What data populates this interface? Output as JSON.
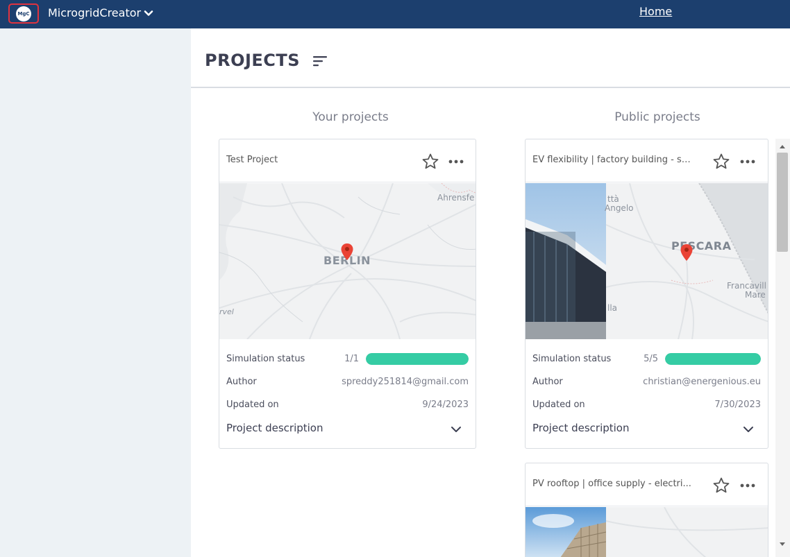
{
  "topbar": {
    "logo_text": "MgC",
    "app_name": "MicrogridCreator",
    "home_link": "Home"
  },
  "page": {
    "title": "PROJECTS"
  },
  "columns": {
    "your_projects": "Your projects",
    "public_projects": "Public projects"
  },
  "labels": {
    "simulation_status": "Simulation status",
    "author": "Author",
    "updated_on": "Updated on",
    "project_description": "Project description"
  },
  "your_project": {
    "title": "Test Project",
    "map_labels": {
      "city": "BERLIN",
      "north": "Ahrensfe",
      "west": "rvel"
    },
    "simulation_count": "1/1",
    "simulation_progress": 1.0,
    "author": "spreddy251814@gmail.com",
    "updated_on": "9/24/2023"
  },
  "public_projects": [
    {
      "title": "EV flexibility | factory building - su...",
      "map_labels": {
        "city": "PESCARA",
        "top1": "ttà",
        "top2": "Angelo",
        "right1": "Francavill",
        "right2": "Mare",
        "bottom": "lla"
      },
      "simulation_count": "5/5",
      "simulation_progress": 1.0,
      "author": "christian@energenious.eu",
      "updated_on": "7/30/2023"
    },
    {
      "title": "PV rooftop | office supply - electri..."
    }
  ],
  "colors": {
    "navbar": "#1c3f6e",
    "accent_red": "#e0333f",
    "progress": "#35cca4",
    "sidebar": "#edf2f5"
  },
  "icons": {
    "sort": "sort-lines-icon",
    "favorite": "star-outline-icon",
    "more": "more-horizontal-icon",
    "expand": "chevron-down-icon",
    "pin": "map-pin-icon"
  }
}
